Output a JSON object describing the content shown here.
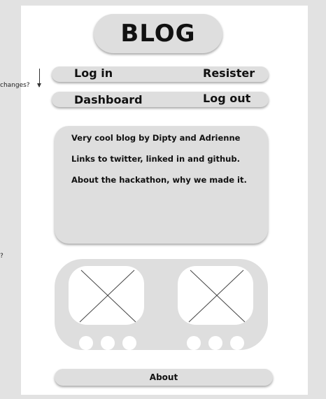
{
  "side_notes": {
    "changes": "changes?",
    "question": "?"
  },
  "header": {
    "title": "BLOG"
  },
  "nav": {
    "login_label": "Log in",
    "register_label": "Resister",
    "dashboard_label": "Dashboard",
    "logout_label": "Log out"
  },
  "about_card": {
    "lines": [
      "Very cool blog by Dipty and Adrienne",
      "Links to twitter, linked in and github.",
      "About the hackathon, why we made it."
    ]
  },
  "footer": {
    "about_label": "About"
  },
  "icons": {
    "image_placeholder": "image-placeholder-icon",
    "carousel_dot": "carousel-dot-icon"
  }
}
